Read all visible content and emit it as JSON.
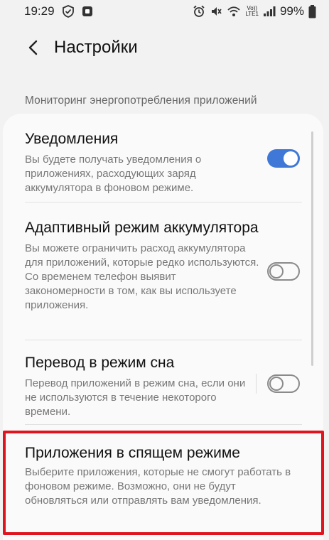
{
  "status": {
    "time": "19:29",
    "battery": "99%",
    "net_tag_top": "Vo))",
    "net_tag_bottom": "LTE1"
  },
  "header": {
    "title": "Настройки"
  },
  "section": {
    "label": "Мониторинг энергопотребления приложений"
  },
  "items": [
    {
      "title": "Уведомления",
      "desc": "Вы будете получать уведомления о приложениях, расходующих заряд аккумулятора в фоновом режиме.",
      "toggle": "on"
    },
    {
      "title": "Адаптивный режим аккумулятора",
      "desc": "Вы можете ограничить расход аккумулятора для приложений, которые редко используются. Со временем телефон выявит закономерности в том, как вы используете приложения.",
      "toggle": "off"
    },
    {
      "title": "Перевод в режим сна",
      "desc": "Перевод приложений в режим сна, если они не используются в течение некоторого времени.",
      "toggle": "off"
    },
    {
      "title": "Приложения в спящем режиме",
      "desc": "Выберите приложения, которые не смогут работать в фоновом режиме. Возможно, они не будут обновляться или отправлять вам уведомления."
    }
  ],
  "colors": {
    "accent": "#3f78d6",
    "highlight": "#e0141e"
  }
}
